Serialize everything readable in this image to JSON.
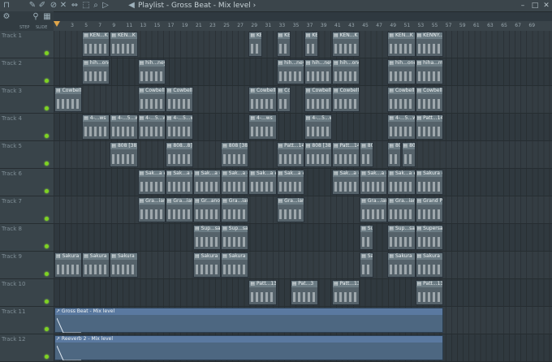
{
  "window": {
    "title": "Playlist - Gross Beat - Mix level",
    "arrow": "›"
  },
  "toolbar": {
    "icons": [
      "magnet-icon",
      "pencil-icon",
      "paint-icon",
      "delete-icon",
      "mute-icon",
      "slip-icon",
      "select-icon",
      "zoom-icon",
      "play-icon",
      "speaker-icon"
    ],
    "step_label": "STEP",
    "slide_label": "SLIDE"
  },
  "window_buttons": {
    "minimize": "–",
    "maximize": "□",
    "close": "✕"
  },
  "ruler": {
    "bars": [
      "3",
      "5",
      "7",
      "9",
      "11",
      "13",
      "15",
      "17",
      "19",
      "21",
      "23",
      "25",
      "27",
      "29",
      "31",
      "33",
      "35",
      "37",
      "39",
      "41",
      "43",
      "45",
      "47",
      "49",
      "51",
      "53",
      "55",
      "57",
      "59",
      "61",
      "63",
      "65",
      "67",
      "69"
    ]
  },
  "tracks": [
    {
      "label": "Track 1",
      "clips": [
        {
          "name": "KEN...K 1",
          "start": 5,
          "len": 4
        },
        {
          "name": "KEN...K 1",
          "start": 9,
          "len": 4
        },
        {
          "name": "KEN...1",
          "start": 29,
          "len": 2
        },
        {
          "name": "KEN...1",
          "start": 33,
          "len": 2
        },
        {
          "name": "KEN...1",
          "start": 37,
          "len": 2
        },
        {
          "name": "KEN...K 1",
          "start": 41,
          "len": 4
        },
        {
          "name": "KEN...K 1",
          "start": 49,
          "len": 4
        },
        {
          "name": "KENNY...CK 1",
          "start": 53,
          "len": 4
        }
      ]
    },
    {
      "label": "Track 2",
      "clips": [
        {
          "name": "hih...oney",
          "start": 5,
          "len": 4
        },
        {
          "name": "hih...ney",
          "start": 13,
          "len": 4
        },
        {
          "name": "hih...ney",
          "start": 33,
          "len": 4
        },
        {
          "name": "hih...ney",
          "start": 37,
          "len": 4
        },
        {
          "name": "hih...oney",
          "start": 41,
          "len": 4
        },
        {
          "name": "hih...oney",
          "start": 49,
          "len": 4
        },
        {
          "name": "hiha...money",
          "start": 53,
          "len": 4
        }
      ]
    },
    {
      "label": "Track 3",
      "clips": [
        {
          "name": "Cowbell",
          "start": 1,
          "len": 4
        },
        {
          "name": "Cowbell",
          "start": 13,
          "len": 4
        },
        {
          "name": "Cowbell",
          "start": 17,
          "len": 4
        },
        {
          "name": "Cowbell",
          "start": 29,
          "len": 4
        },
        {
          "name": "Co...ll",
          "start": 33,
          "len": 2
        },
        {
          "name": "Cowbell",
          "start": 37,
          "len": 4
        },
        {
          "name": "Cowbell",
          "start": 41,
          "len": 4
        },
        {
          "name": "Cowbell",
          "start": 49,
          "len": 4
        },
        {
          "name": "Cowbell",
          "start": 53,
          "len": 4
        }
      ]
    },
    {
      "label": "Track 4",
      "clips": [
        {
          "name": "4-...ws",
          "start": 5,
          "len": 4
        },
        {
          "name": "4-...5...ws",
          "start": 9,
          "len": 4
        },
        {
          "name": "4-...5...ws",
          "start": 13,
          "len": 4
        },
        {
          "name": "4-...5...ws",
          "start": 17,
          "len": 4
        },
        {
          "name": "4-...ws",
          "start": 29,
          "len": 4
        },
        {
          "name": "4-...5...ws",
          "start": 37,
          "len": 4
        },
        {
          "name": "4-...5...ws",
          "start": 49,
          "len": 4
        },
        {
          "name": "Patt...14",
          "start": 53,
          "len": 4
        }
      ]
    },
    {
      "label": "Track 5",
      "clips": [
        {
          "name": "808 [38]",
          "start": 9,
          "len": 4
        },
        {
          "name": "808...8]",
          "start": 17,
          "len": 4
        },
        {
          "name": "808 [38]",
          "start": 25,
          "len": 4
        },
        {
          "name": "Patt...14",
          "start": 33,
          "len": 4
        },
        {
          "name": "808 [38]",
          "start": 37,
          "len": 4
        },
        {
          "name": "Patt...14",
          "start": 41,
          "len": 4
        },
        {
          "name": "808 [38]",
          "start": 45,
          "len": 2
        },
        {
          "name": "808 [38]",
          "start": 49,
          "len": 2
        },
        {
          "name": "808 [38]",
          "start": 51,
          "len": 2
        }
      ]
    },
    {
      "label": "Track 6",
      "clips": [
        {
          "name": "Sak...a #2",
          "start": 13,
          "len": 4
        },
        {
          "name": "Sak...a #3",
          "start": 17,
          "len": 4
        },
        {
          "name": "Sak...a #2",
          "start": 21,
          "len": 4
        },
        {
          "name": "Sak...a #2",
          "start": 25,
          "len": 4
        },
        {
          "name": "Sak...a #2",
          "start": 29,
          "len": 4
        },
        {
          "name": "Sak...a #2",
          "start": 33,
          "len": 4
        },
        {
          "name": "Sak...a #2",
          "start": 41,
          "len": 4
        },
        {
          "name": "Sak...a #2",
          "start": 45,
          "len": 4
        },
        {
          "name": "Sak...a #4",
          "start": 49,
          "len": 4
        },
        {
          "name": "Sakura #4",
          "start": 53,
          "len": 4
        }
      ]
    },
    {
      "label": "Track 7",
      "clips": [
        {
          "name": "Gra...iano",
          "start": 13,
          "len": 4
        },
        {
          "name": "Gra...iano",
          "start": 17,
          "len": 4
        },
        {
          "name": "Gr...ano",
          "start": 21,
          "len": 4
        },
        {
          "name": "Gra...iano",
          "start": 25,
          "len": 4
        },
        {
          "name": "Gra...iano",
          "start": 33,
          "len": 4
        },
        {
          "name": "Gra...iano",
          "start": 45,
          "len": 4
        },
        {
          "name": "Gra...iano",
          "start": 49,
          "len": 4
        },
        {
          "name": "Grand Piano",
          "start": 53,
          "len": 4
        }
      ]
    },
    {
      "label": "Track 8",
      "clips": [
        {
          "name": "Sup...saw",
          "start": 21,
          "len": 4
        },
        {
          "name": "Sup...saw",
          "start": 25,
          "len": 4
        },
        {
          "name": "Su...w",
          "start": 45,
          "len": 2
        },
        {
          "name": "Sup...saw",
          "start": 49,
          "len": 4
        },
        {
          "name": "Supersaw",
          "start": 53,
          "len": 4
        }
      ]
    },
    {
      "label": "Track 9",
      "clips": [
        {
          "name": "Sakura",
          "start": 1,
          "len": 4
        },
        {
          "name": "Sakura",
          "start": 5,
          "len": 4
        },
        {
          "name": "Sakura",
          "start": 9,
          "len": 4
        },
        {
          "name": "Sakura",
          "start": 21,
          "len": 4
        },
        {
          "name": "Sakura",
          "start": 25,
          "len": 4
        },
        {
          "name": "Sa...ra",
          "start": 45,
          "len": 2
        },
        {
          "name": "Sakura",
          "start": 49,
          "len": 4
        },
        {
          "name": "Sakura",
          "start": 53,
          "len": 4
        }
      ]
    },
    {
      "label": "Track 10",
      "clips": [
        {
          "name": "Patt...13",
          "start": 29,
          "len": 4
        },
        {
          "name": "Pat...3",
          "start": 35,
          "len": 4
        },
        {
          "name": "Patt...13",
          "start": 41,
          "len": 4
        },
        {
          "name": "Patt...13",
          "start": 53,
          "len": 4
        }
      ]
    },
    {
      "label": "Track 11",
      "automation": {
        "name": "Gross Beat - Mix level",
        "start": 1,
        "len": 56
      }
    },
    {
      "label": "Track 12",
      "automation": {
        "name": "Reeverb 2 - Mix level",
        "start": 1,
        "len": 56
      }
    }
  ],
  "colors": {
    "accent": "#7ed321",
    "clip": "#55626a",
    "automation": "#4d6781"
  }
}
